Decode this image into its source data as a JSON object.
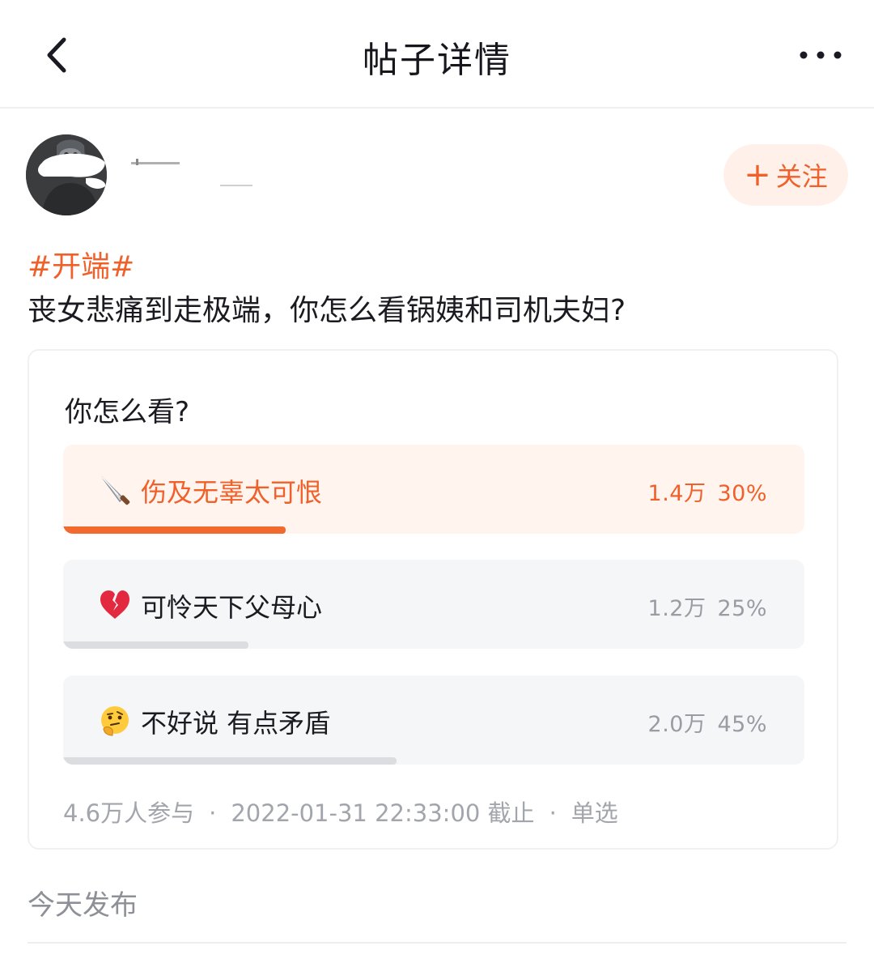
{
  "header": {
    "title": "帖子详情"
  },
  "author": {
    "follow_label": "关注"
  },
  "post": {
    "topic": "#开端#",
    "title": "丧女悲痛到走极端，你怎么看锅姨和司机夫妇?"
  },
  "poll": {
    "question": "你怎么看?",
    "options": [
      {
        "emoji": "knife",
        "label": "伤及无辜太可恨",
        "count": "1.4万",
        "percent": "30%",
        "fraction": 0.3,
        "selected": true
      },
      {
        "emoji": "broken-heart",
        "label": "可怜天下父母心",
        "count": "1.2万",
        "percent": "25%",
        "fraction": 0.25,
        "selected": false
      },
      {
        "emoji": "thinking-face",
        "label": "不好说 有点矛盾",
        "count": "2.0万",
        "percent": "45%",
        "fraction": 0.45,
        "selected": false
      }
    ],
    "participants": "4.6万人参与",
    "deadline": "2022-01-31 22:33:00 截止",
    "mode": "单选"
  },
  "publish_time": "今天发布",
  "colors": {
    "accent": "#f0602a",
    "follow_bg": "#fff1ea",
    "selected_option_bg": "#fff4ee",
    "option_bg": "#f5f6f8",
    "bar_gray": "#dcdde1"
  }
}
